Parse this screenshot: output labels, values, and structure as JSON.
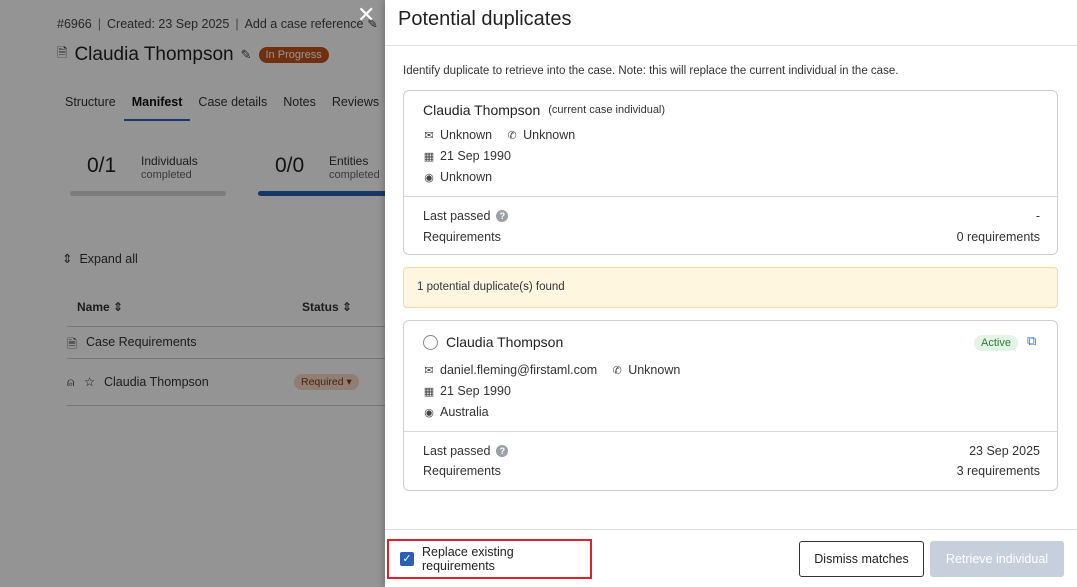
{
  "background": {
    "case_id": "#6966",
    "created": "Created: 23 Sep 2025",
    "add_reference": "Add a case reference",
    "case_name": "Claudia Thompson",
    "status_badge": "In Progress",
    "tabs": [
      {
        "label": "Structure"
      },
      {
        "label": "Manifest",
        "active": true
      },
      {
        "label": "Case details"
      },
      {
        "label": "Notes"
      },
      {
        "label": "Reviews"
      }
    ],
    "stats": [
      {
        "value": "0/1",
        "label": "Individuals",
        "sub": "completed",
        "progress": 0
      },
      {
        "value": "0/0",
        "label": "Entities",
        "sub": "completed",
        "progress": 1
      }
    ],
    "expand_all": "Expand all",
    "table": {
      "col_name": "Name",
      "col_status": "Status",
      "rows": [
        {
          "name": "Case Requirements",
          "status": ""
        },
        {
          "name": "Claudia Thompson",
          "status": "Required ▾"
        }
      ]
    }
  },
  "modal": {
    "title": "Potential duplicates",
    "intro": "Identify duplicate to retrieve into the case. Note: this will replace the current individual in the case.",
    "current": {
      "name": "Claudia Thompson",
      "tag": "(current case individual)",
      "email": "Unknown",
      "phone": "Unknown",
      "dob": "21 Sep 1990",
      "location": "Unknown",
      "last_passed_label": "Last passed",
      "last_passed_value": "-",
      "requirements_label": "Requirements",
      "requirements_value": "0 requirements"
    },
    "notice": "1 potential duplicate(s) found",
    "match": {
      "name": "Claudia Thompson",
      "status": "Active",
      "email": "daniel.fleming@firstaml.com",
      "phone": "Unknown",
      "dob": "21 Sep 1990",
      "location": "Australia",
      "last_passed_label": "Last passed",
      "last_passed_value": "23 Sep 2025",
      "requirements_label": "Requirements",
      "requirements_value": "3 requirements"
    },
    "replace_label": "Replace existing requirements",
    "replace_checked": true,
    "dismiss_label": "Dismiss matches",
    "retrieve_label": "Retrieve individual"
  }
}
